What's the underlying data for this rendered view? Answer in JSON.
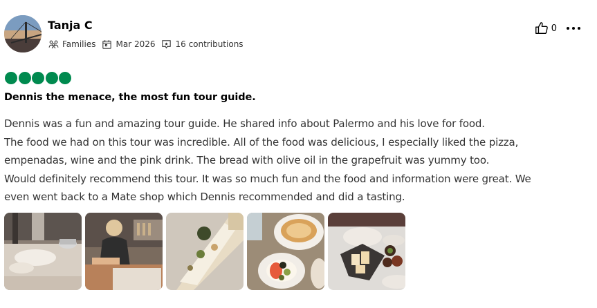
{
  "reviewer": {
    "name": "Tanja C",
    "trip_type": "Families",
    "date": "Mar 2026",
    "contributions": "16 contributions"
  },
  "actions": {
    "helpful_count": "0"
  },
  "rating": {
    "value": 5,
    "max": 5
  },
  "review": {
    "title": "Dennis the menace, the most fun tour guide.",
    "lines": [
      "Dennis was a fun and amazing tour guide. He shared info about Palermo and his love for food.",
      "The food we had on this tour was incredible. All of the food was delicious, I especially liked the pizza,",
      "empenadas, wine and the pink drink. The bread with olive oil in the grapefruit was yummy too.",
      "Would definitely recommend this tour. It was so much fun and the food and information were great. We",
      "even went back to a Mate shop which Dennis recommended and did a tasting."
    ]
  },
  "colors": {
    "rating_green": "#008a4f",
    "text": "#333333"
  },
  "icons": {
    "trip_type": "family-icon",
    "date": "calendar-icon",
    "contributions": "contributions-icon",
    "helpful": "thumbs-up-icon",
    "more": "more-options-icon"
  }
}
